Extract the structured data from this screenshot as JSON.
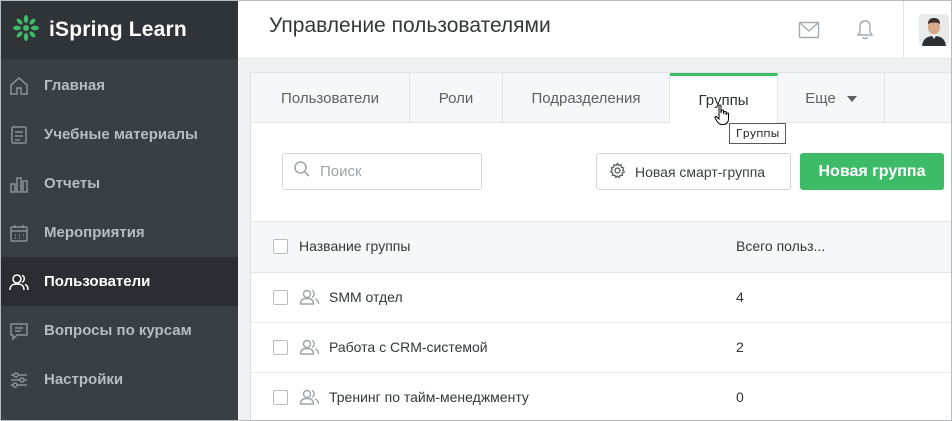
{
  "brand": {
    "name": "iSpring Learn",
    "logo_color": "#3dbb66"
  },
  "sidebar": {
    "items": [
      {
        "label": "Главная",
        "icon": "home-icon",
        "active": false
      },
      {
        "label": "Учебные материалы",
        "icon": "book-icon",
        "active": false
      },
      {
        "label": "Отчеты",
        "icon": "bar-chart-icon",
        "active": false
      },
      {
        "label": "Мероприятия",
        "icon": "calendar-icon",
        "active": false
      },
      {
        "label": "Пользователи",
        "icon": "users-icon",
        "active": true
      },
      {
        "label": "Вопросы по курсам",
        "icon": "chat-icon",
        "active": false
      },
      {
        "label": "Настройки",
        "icon": "sliders-icon",
        "active": false
      }
    ]
  },
  "header": {
    "title": "Управление пользователями",
    "icons": [
      "mail-icon",
      "bell-icon",
      "avatar"
    ]
  },
  "tabs": {
    "items": [
      {
        "label": "Пользователи"
      },
      {
        "label": "Роли"
      },
      {
        "label": "Подразделения"
      },
      {
        "label": "Группы",
        "active": true
      },
      {
        "label": "Еще"
      }
    ],
    "tooltip": "Группы"
  },
  "toolbar": {
    "search_placeholder": "Поиск",
    "smart_group_label": "Новая смарт-группа",
    "new_group_label": "Новая группа"
  },
  "table": {
    "columns": [
      "Название группы",
      "Всего польз..."
    ],
    "rows": [
      {
        "name": "SMM отдел",
        "count": "4"
      },
      {
        "name": "Работа с CRM-системой",
        "count": "2"
      },
      {
        "name": "Тренинг по тайм-менеджменту",
        "count": "0"
      }
    ]
  },
  "colors": {
    "accent": "#3dbb66",
    "sidebar": "#3a3f44"
  }
}
